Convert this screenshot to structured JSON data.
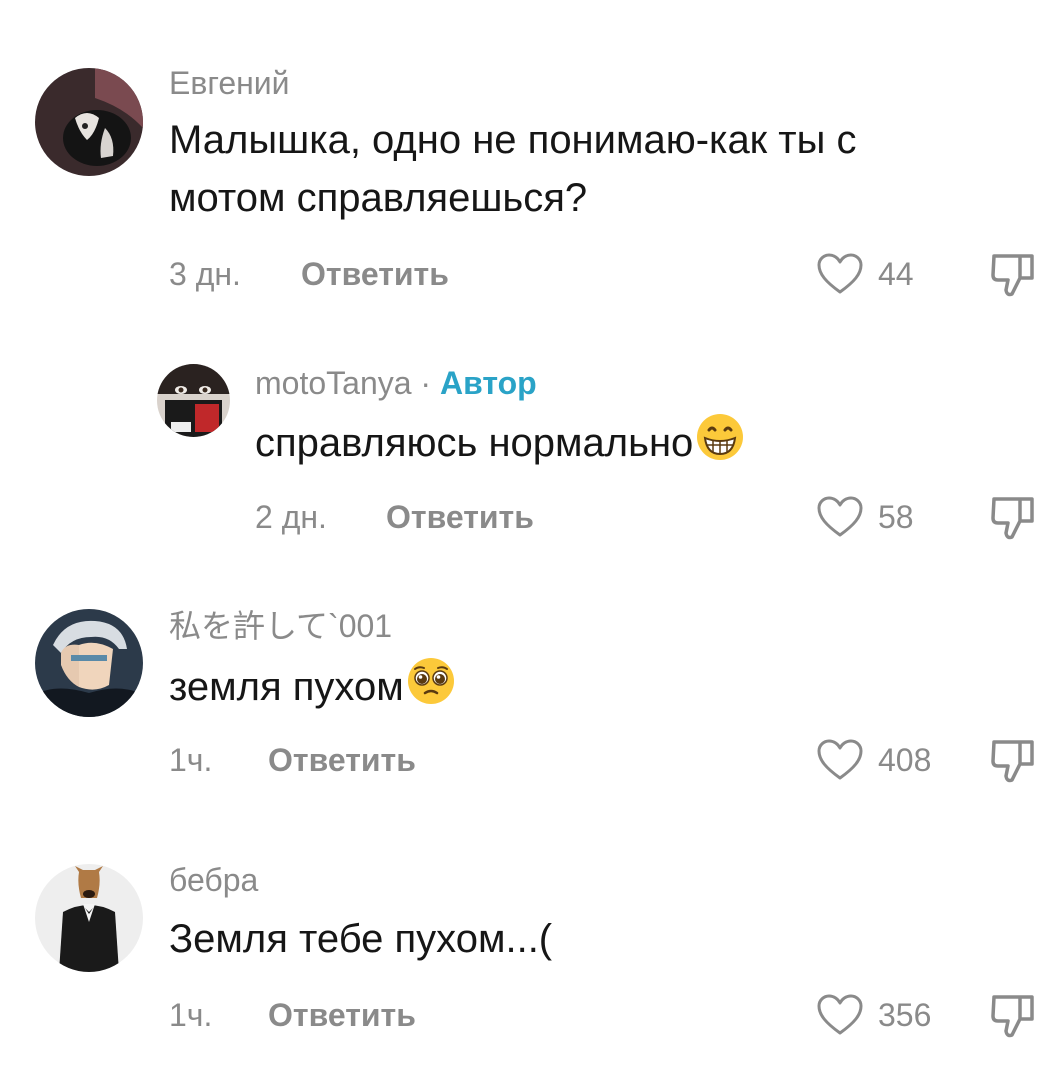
{
  "comments": [
    {
      "username": "Евгений",
      "text_lines": [
        "Малышка, одно не понимаю-как ты с",
        "мотом справляешься?"
      ],
      "time": "3 дн.",
      "reply_label": "Ответить",
      "likes": "44"
    },
    {
      "username": "motoTanya",
      "separator": "·",
      "badge": "Автор",
      "text": "справляюсь нормально",
      "emoji": "grinning-face-emoji",
      "time": "2 дн.",
      "reply_label": "Ответить",
      "likes": "58"
    },
    {
      "username": "私を許して`001",
      "text": "земля пухом",
      "emoji": "pleading-face-emoji",
      "time": "1ч.",
      "reply_label": "Ответить",
      "likes": "408"
    },
    {
      "username": "бебра",
      "text": "Земля тебе пухом...(",
      "time": "1ч.",
      "reply_label": "Ответить",
      "likes": "356"
    }
  ],
  "icons": {
    "like": "heart-outline-icon",
    "dislike": "thumbs-down-outline-icon"
  },
  "colors": {
    "author_badge": "#2aa3c7",
    "muted_text": "#8a8a8a",
    "body_text": "#161616"
  }
}
